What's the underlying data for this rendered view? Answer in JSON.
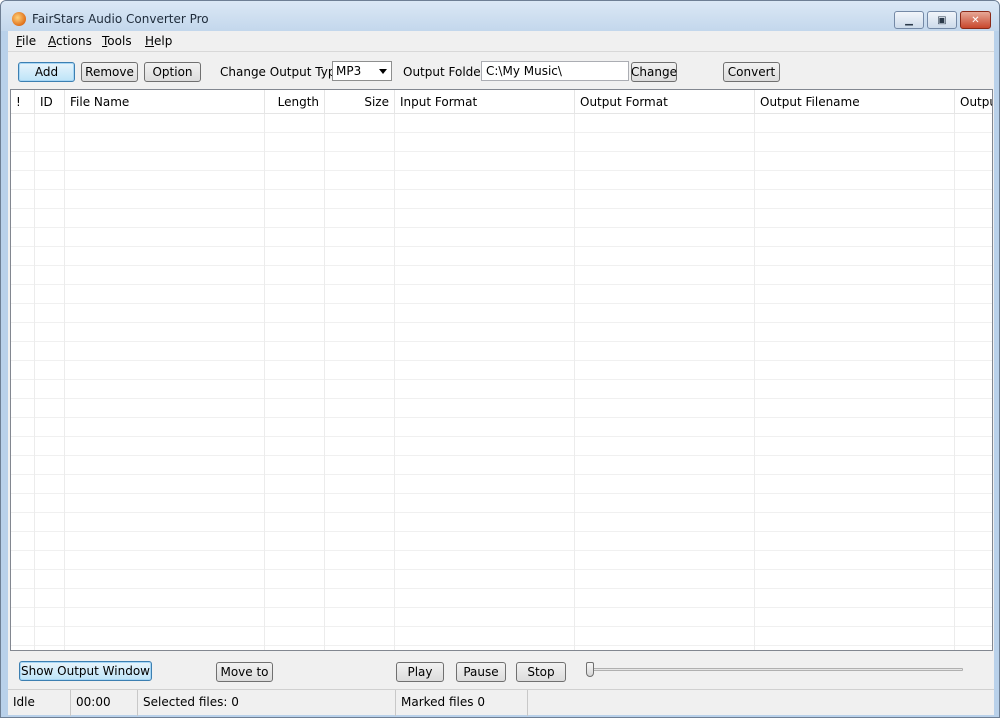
{
  "window": {
    "title": "FairStars Audio Converter Pro"
  },
  "menu": [
    "File",
    "Actions",
    "Tools",
    "Help"
  ],
  "toolbar": {
    "add_label": "Add",
    "remove_label": "Remove",
    "option_label": "Option",
    "output_type_label": "Change Output Type:",
    "output_type_value": "MP3",
    "output_folder_label": "Output Folder:",
    "output_folder_value": "C:\\My Music\\",
    "change_label": "Change",
    "convert_label": "Convert"
  },
  "table": {
    "columns": [
      "!",
      "ID",
      "File Name",
      "Length",
      "Size",
      "Input Format",
      "Output Format",
      "Output Filename",
      "Outpu"
    ],
    "rows": []
  },
  "bottom": {
    "show_output_label": "Show Output Window",
    "move_to_label": "Move to",
    "play_label": "Play",
    "pause_label": "Pause",
    "stop_label": "Stop",
    "playback_position": 0
  },
  "status": {
    "state": "Idle",
    "time": "00:00",
    "selected": "Selected files: 0",
    "marked": "Marked files 0"
  }
}
